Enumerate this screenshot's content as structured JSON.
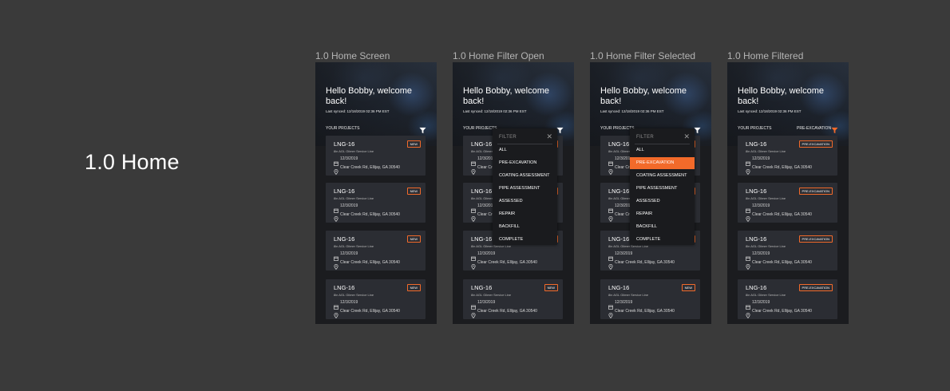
{
  "section_title": "1.0 Home",
  "accent_color": "#f26a2a",
  "frames": [
    {
      "label": "1.0 Home Screen",
      "variant": "home"
    },
    {
      "label": "1.0 Home Filter Open",
      "variant": "filter-open"
    },
    {
      "label": "1.0 Home Filter Selected",
      "variant": "filter-selected"
    },
    {
      "label": "1.0 Home Filtered",
      "variant": "filtered"
    }
  ],
  "screen": {
    "greeting": "Hello Bobby, welcome back!",
    "last_synced": "Last synced: 12/18/2019 02:36 PM EST",
    "your_projects": "YOUR PROJECTS",
    "active_filter": "PRE-EXCAVATION",
    "cards": [
      {
        "title": "LNG-16",
        "subtitle": "8in AGL Gilmer Service Line",
        "date": "12/3/2019",
        "address": "Clear Creek Rd, Ellijay, GA 30540",
        "badge": "NEW",
        "filtered_badge": "PRE-EXCAVATION"
      },
      {
        "title": "LNG-16",
        "subtitle": "8in AGL Gilmer Service Line",
        "date": "12/3/2019",
        "address": "Clear Creek Rd, Ellijay, GA 30540",
        "badge": "NEW",
        "filtered_badge": "PRE-EXCAVATION"
      },
      {
        "title": "LNG-16",
        "subtitle": "8in AGL Gilmer Service Line",
        "date": "12/3/2019",
        "address": "Clear Creek Rd, Ellijay, GA 30540",
        "badge": "NEW",
        "filtered_badge": "PRE-EXCAVATION"
      },
      {
        "title": "LNG-16",
        "subtitle": "8in AGL Gilmer Service Line",
        "date": "12/3/2019",
        "address": "Clear Creek Rd, Ellijay, GA 30540",
        "badge": "NEW",
        "filtered_badge": "PRE-EXCAVATION"
      }
    ],
    "filter_menu": {
      "title": "FILTER",
      "close_icon": "close-icon",
      "options": [
        "ALL",
        "PRE-EXCAVATION",
        "COATING ASSESSMENT",
        "PIPE ASSESSMENT",
        "ASSESSED",
        "REPAIR",
        "BACKFILL",
        "COMPLETE"
      ],
      "selected": "PRE-EXCAVATION"
    }
  }
}
